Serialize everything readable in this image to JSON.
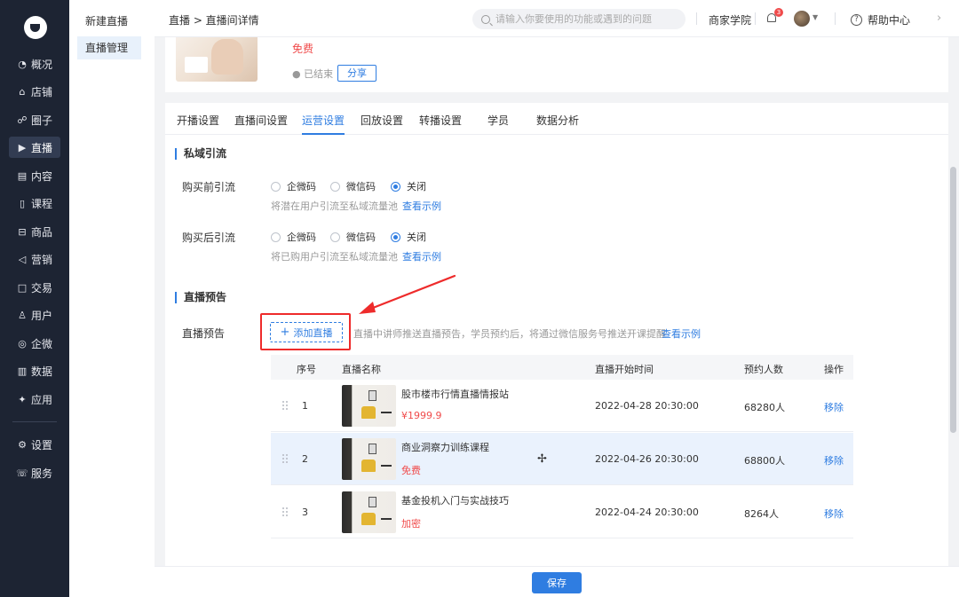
{
  "sidebar": {
    "items": [
      {
        "label": "概况",
        "icon": "clock-icon",
        "glyph": "◔"
      },
      {
        "label": "店铺",
        "icon": "store-icon",
        "glyph": "⌂"
      },
      {
        "label": "圈子",
        "icon": "group-icon",
        "glyph": "☍"
      },
      {
        "label": "直播",
        "icon": "live-video-icon",
        "glyph": "▶"
      },
      {
        "label": "内容",
        "icon": "content-icon",
        "glyph": "▤"
      },
      {
        "label": "课程",
        "icon": "course-icon",
        "glyph": "▯"
      },
      {
        "label": "商品",
        "icon": "product-icon",
        "glyph": "⊟"
      },
      {
        "label": "营销",
        "icon": "megaphone-icon",
        "glyph": "◁"
      },
      {
        "label": "交易",
        "icon": "transaction-icon",
        "glyph": "□"
      },
      {
        "label": "用户",
        "icon": "user-icon",
        "glyph": "♙"
      },
      {
        "label": "企微",
        "icon": "wecom-icon",
        "glyph": "◎"
      },
      {
        "label": "数据",
        "icon": "data-icon",
        "glyph": "▥"
      },
      {
        "label": "应用",
        "icon": "apps-icon",
        "glyph": "✦"
      },
      {
        "label": "设置",
        "icon": "settings-icon",
        "glyph": "⚙"
      },
      {
        "label": "服务",
        "icon": "service-icon",
        "glyph": "☏"
      }
    ],
    "active_index": 3
  },
  "subnav": {
    "items": [
      "新建直播",
      "直播管理"
    ],
    "active_index": 1
  },
  "header": {
    "breadcrumb": "直播 > 直播间详情",
    "search_placeholder": "请输入你要使用的功能或遇到的问题",
    "academy": "商家学院",
    "notification_count": "3",
    "help": "帮助中心"
  },
  "course": {
    "price": "免费",
    "status": "● 已结束",
    "share": "分享"
  },
  "tabs": {
    "items": [
      "开播设置",
      "直播间设置",
      "运营设置",
      "回放设置",
      "转播设置",
      "学员",
      "数据分析"
    ],
    "active_index": 2
  },
  "private_traffic": {
    "title": "私域引流",
    "before": {
      "label": "购买前引流",
      "options": [
        "企微码",
        "微信码",
        "关闭"
      ],
      "selected": 2,
      "hint": "将潜在用户引流至私域流量池",
      "link": "查看示例"
    },
    "after": {
      "label": "购买后引流",
      "options": [
        "企微码",
        "微信码",
        "关闭"
      ],
      "selected": 2,
      "hint": "将已购用户引流至私域流量池",
      "link": "查看示例"
    }
  },
  "preview": {
    "title": "直播预告",
    "label": "直播预告",
    "add_button": "添加直播",
    "hint": "直播中讲师推送直播预告，学员预约后，将通过微信服务号推送开课提醒",
    "link": "查看示例",
    "columns": [
      "序号",
      "直播名称",
      "直播开始时间",
      "预约人数",
      "操作"
    ],
    "rows": [
      {
        "index": "1",
        "name": "股市楼市行情直播情报站",
        "price": "¥1999.9",
        "time": "2022-04-28  20:30:00",
        "count": "68280人",
        "action": "移除"
      },
      {
        "index": "2",
        "name": "商业洞察力训练课程",
        "price": "免费",
        "time": "2022-04-26  20:30:00",
        "count": "68800人",
        "action": "移除"
      },
      {
        "index": "3",
        "name": "基金投机入门与实战技巧",
        "price": "加密",
        "time": "2022-04-24  20:30:00",
        "count": "8264人",
        "action": "移除"
      }
    ],
    "hover_row": 1
  },
  "footer": {
    "save": "保存"
  },
  "colors": {
    "accent": "#2f7de1",
    "danger": "#f04b4b",
    "highlight": "#ee2b2b",
    "nav_bg": "#1d2433"
  }
}
